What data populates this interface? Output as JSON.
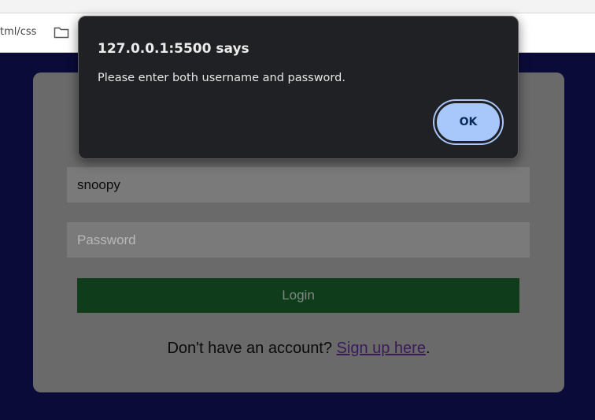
{
  "browser": {
    "bookmark_path": "tml/css",
    "folder_icon": "folder-icon"
  },
  "login_form": {
    "username_value": "snoopy",
    "password_placeholder": "Password",
    "password_value": "",
    "login_label": "Login",
    "signup_prompt": "Don't have an account?",
    "signup_link": "Sign up here",
    "signup_trailing": "."
  },
  "alert": {
    "title": "127.0.0.1:5500 says",
    "message": "Please enter both username and password.",
    "ok_label": "OK",
    "button_color": "#a8c7fa"
  },
  "colors": {
    "page_background": "#0b0b3a",
    "card_background": "#6a6a6a",
    "login_button": "#0f3d1b",
    "link": "#3b1a5a"
  }
}
